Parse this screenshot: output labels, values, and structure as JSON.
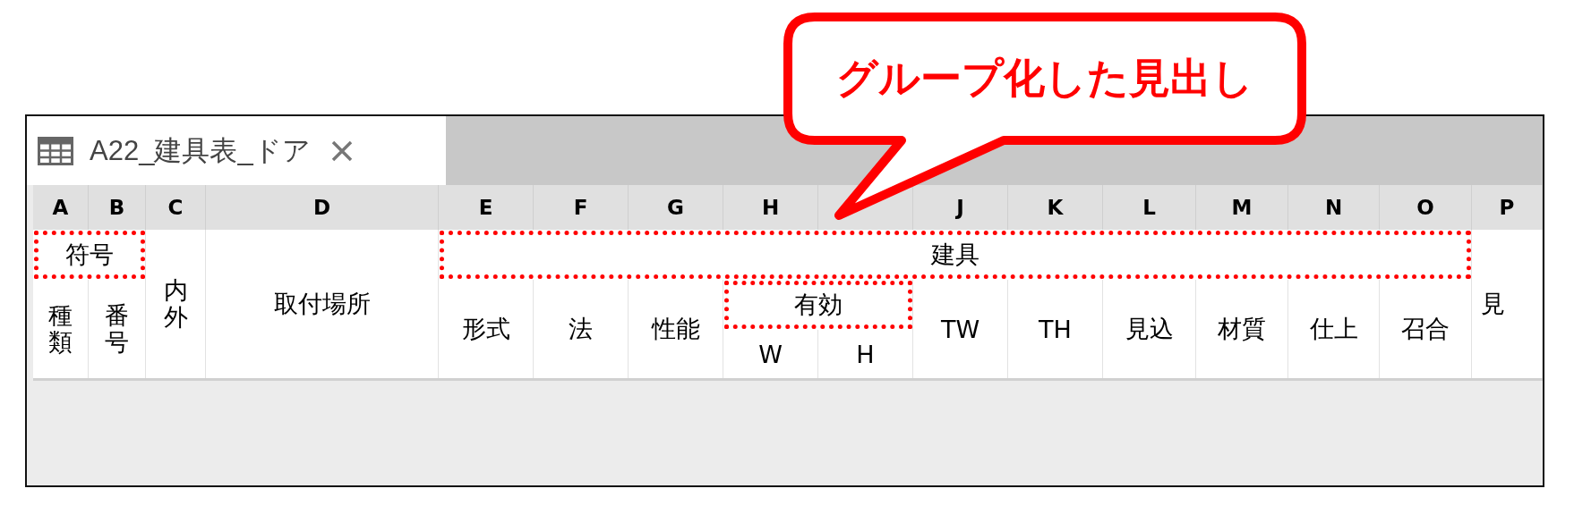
{
  "callout": {
    "text": "グループ化した見出し"
  },
  "tab": {
    "title": "A22_建具表_ドア",
    "selected": true
  },
  "columns": [
    {
      "letter": "A"
    },
    {
      "letter": "B"
    },
    {
      "letter": "C"
    },
    {
      "letter": "D"
    },
    {
      "letter": "E"
    },
    {
      "letter": "F"
    },
    {
      "letter": "G"
    },
    {
      "letter": "H"
    },
    {},
    {
      "letter": "J"
    },
    {
      "letter": "K"
    },
    {
      "letter": "L"
    },
    {
      "letter": "M"
    },
    {
      "letter": "N"
    },
    {
      "letter": "O"
    },
    {
      "letter": "P"
    }
  ],
  "header_groups": [
    {
      "text": "符号",
      "highlighted": true,
      "children": [
        {
          "text": "種類",
          "vertical": true,
          "highlighted": false
        },
        {
          "text": "番号",
          "vertical": true,
          "highlighted": false
        }
      ]
    },
    {
      "text": "内外",
      "vertical": true,
      "highlighted": false
    },
    {
      "text": "取付場所",
      "highlighted": false
    },
    {
      "text": "建具",
      "highlighted": true,
      "children": [
        {
          "text": "形式",
          "highlighted": false
        },
        {
          "text": "法",
          "highlighted": false
        },
        {
          "text": "性能",
          "highlighted": false
        },
        {
          "text": "有効",
          "highlighted": true,
          "children": [
            {
              "text": "W",
              "highlighted": false
            },
            {
              "text": "H",
              "highlighted": false
            }
          ]
        },
        {
          "text": "TW",
          "highlighted": false
        },
        {
          "text": "TH",
          "highlighted": false
        },
        {
          "text": "見込",
          "highlighted": false
        },
        {
          "text": "材質",
          "highlighted": false
        },
        {
          "text": "仕上",
          "highlighted": false
        },
        {
          "text": "召合",
          "highlighted": false
        }
      ]
    },
    {
      "text": "見",
      "highlighted": false,
      "cut": true
    }
  ]
}
